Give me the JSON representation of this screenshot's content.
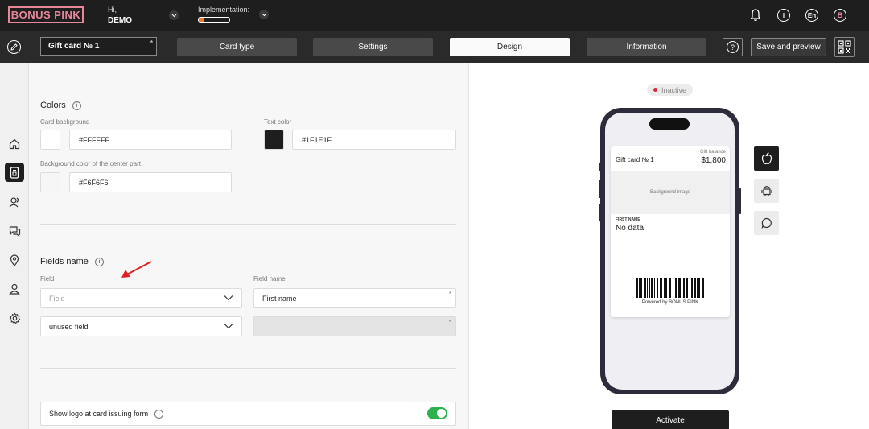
{
  "brand": {
    "logo_text": "BONUS PINK",
    "accent": "#e8879a"
  },
  "header": {
    "greeting": "Hi,",
    "user": "DEMO",
    "implementation_label": "Implementation:",
    "implementation_progress": 0.15,
    "lang": "En",
    "avatar": "B"
  },
  "nav": {
    "card_name": "Gift card № 1",
    "required_mark": "*",
    "steps": [
      "Card type",
      "Settings",
      "Design",
      "Information"
    ],
    "active_step": "Design",
    "save_label": "Save and preview",
    "help_icon": "?"
  },
  "sidebar": {
    "items": [
      "home-icon",
      "card-icon",
      "clients-icon",
      "chat-icon",
      "location-icon",
      "user-icon",
      "gear-icon"
    ],
    "active": "card-icon"
  },
  "colors_section": {
    "title": "Colors",
    "card_background_label": "Card background",
    "card_background_value": "#FFFFFF",
    "text_color_label": "Text color",
    "text_color_value": "#1F1E1F",
    "center_bg_label": "Background color of the center part",
    "center_bg_value": "#F6F6F6"
  },
  "fields_section": {
    "title": "Fields name",
    "field_label": "Field",
    "field_name_label": "Field name",
    "row1_field_placeholder": "Field",
    "row1_field_name": "First name",
    "row2_field": "unused field",
    "row2_field_name": "",
    "required_mark": "*"
  },
  "logo_toggle": {
    "label": "Show logo at card issuing form",
    "on": true
  },
  "preview": {
    "status": "Inactive",
    "card": {
      "name": "Gift card № 1",
      "balance_label": "Gift balance",
      "balance_value": "$1,800",
      "bg_image_label": "Background image",
      "first_name_label": "FIRST NAME",
      "first_name_value": "No data",
      "powered": "Powered by BONUS PINK"
    },
    "os_buttons": [
      "apple-icon",
      "android-icon",
      "message-icon"
    ],
    "activate_label": "Activate"
  }
}
